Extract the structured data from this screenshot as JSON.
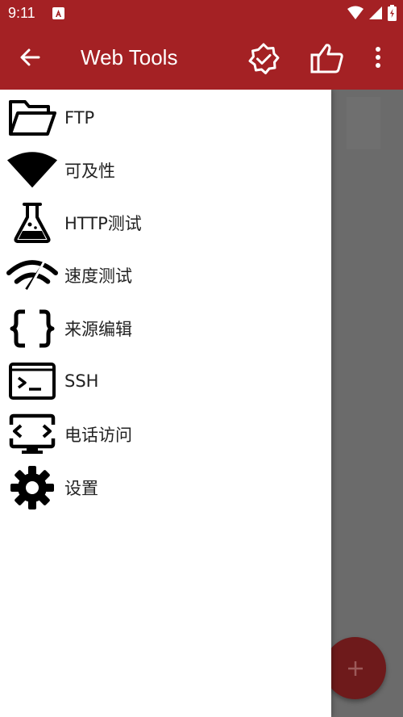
{
  "status_bar": {
    "time": "9:11"
  },
  "app_bar": {
    "title": "Web Tools"
  },
  "drawer": {
    "items": [
      {
        "label": "FTP",
        "icon": "folder-open-icon"
      },
      {
        "label": "可及性",
        "icon": "wifi-icon"
      },
      {
        "label": "HTTP测试",
        "icon": "flask-icon"
      },
      {
        "label": "速度测试",
        "icon": "speed-icon"
      },
      {
        "label": "来源编辑",
        "icon": "braces-icon"
      },
      {
        "label": "SSH",
        "icon": "terminal-icon"
      },
      {
        "label": "电话访问",
        "icon": "monitor-code-icon"
      },
      {
        "label": "设置",
        "icon": "gear-icon"
      }
    ]
  },
  "colors": {
    "primary": "#a42124",
    "scrim": "#6b6b6b",
    "fab": "#6e1a1b"
  }
}
